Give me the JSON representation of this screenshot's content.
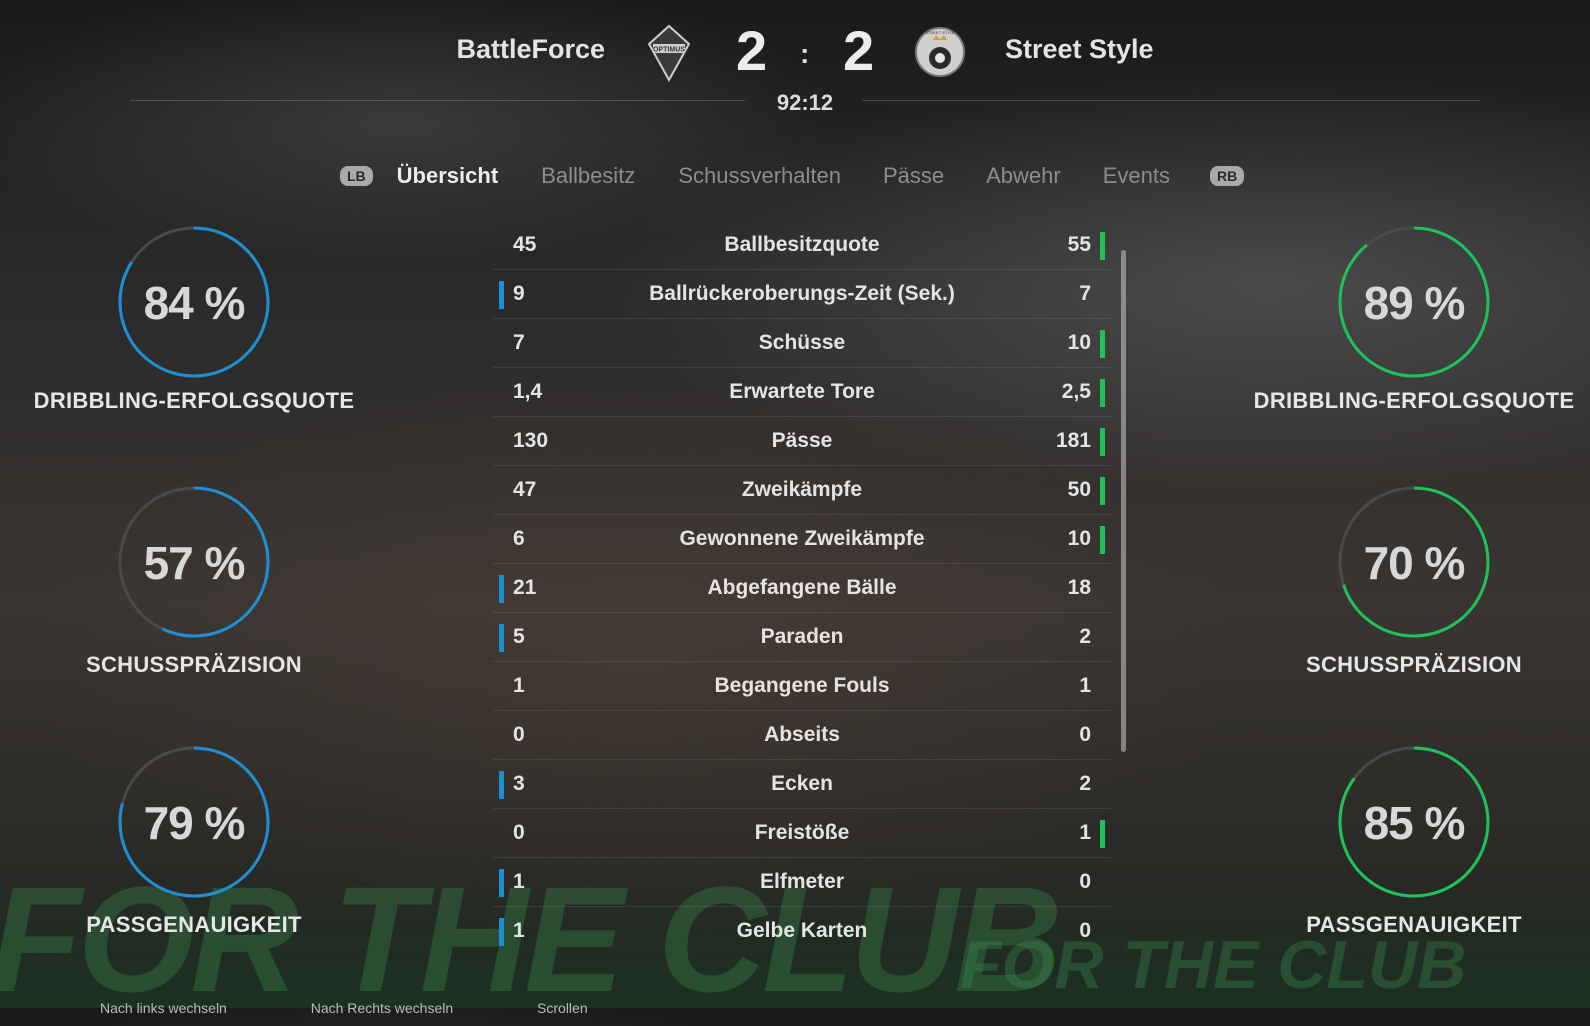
{
  "header": {
    "home_team": "BattleForce",
    "away_team": "Street Style",
    "home_score": "2",
    "away_score": "2",
    "separator": ":",
    "match_clock": "92:12",
    "home_crest_text": "OPTIMUS",
    "away_crest_text": "STREET STYLE"
  },
  "tabs": {
    "left_bumper": "LB",
    "right_bumper": "RB",
    "items": [
      "Übersicht",
      "Ballbesitz",
      "Schussverhalten",
      "Pässe",
      "Abwehr",
      "Events"
    ],
    "active_index": 0
  },
  "home_gauges": [
    {
      "value": "84 %",
      "percent": 84,
      "label": "DRIBBLING-ERFOLGSQUOTE"
    },
    {
      "value": "57 %",
      "percent": 57,
      "label": "SCHUSSPRÄZISION"
    },
    {
      "value": "79 %",
      "percent": 79,
      "label": "PASSGENAUIGKEIT"
    }
  ],
  "away_gauges": [
    {
      "value": "89 %",
      "percent": 89,
      "label": "DRIBBLING-ERFOLGSQUOTE"
    },
    {
      "value": "70 %",
      "percent": 70,
      "label": "SCHUSSPRÄZISION"
    },
    {
      "value": "85 %",
      "percent": 85,
      "label": "PASSGENAUIGKEIT"
    }
  ],
  "stats": [
    {
      "home": "45",
      "name": "Ballbesitzquote",
      "away": "55",
      "leader": "away"
    },
    {
      "home": "9",
      "name": "Ballrückeroberungs-Zeit (Sek.)",
      "away": "7",
      "leader": "home"
    },
    {
      "home": "7",
      "name": "Schüsse",
      "away": "10",
      "leader": "away"
    },
    {
      "home": "1,4",
      "name": "Erwartete Tore",
      "away": "2,5",
      "leader": "away"
    },
    {
      "home": "130",
      "name": "Pässe",
      "away": "181",
      "leader": "away"
    },
    {
      "home": "47",
      "name": "Zweikämpfe",
      "away": "50",
      "leader": "away"
    },
    {
      "home": "6",
      "name": "Gewonnene Zweikämpfe",
      "away": "10",
      "leader": "away"
    },
    {
      "home": "21",
      "name": "Abgefangene Bälle",
      "away": "18",
      "leader": "home"
    },
    {
      "home": "5",
      "name": "Paraden",
      "away": "2",
      "leader": "home"
    },
    {
      "home": "1",
      "name": "Begangene Fouls",
      "away": "1",
      "leader": "none"
    },
    {
      "home": "0",
      "name": "Abseits",
      "away": "0",
      "leader": "none"
    },
    {
      "home": "3",
      "name": "Ecken",
      "away": "2",
      "leader": "home"
    },
    {
      "home": "0",
      "name": "Freistöße",
      "away": "1",
      "leader": "away"
    },
    {
      "home": "1",
      "name": "Elfmeter",
      "away": "0",
      "leader": "home"
    },
    {
      "home": "1",
      "name": "Gelbe Karten",
      "away": "0",
      "leader": "home"
    }
  ],
  "background": {
    "banner_text": "FOR THE CLUB",
    "banner_text_small": "FOR THE CLUB"
  },
  "footer": {
    "hint_left": "Nach links wechseln",
    "hint_right": "Nach Rechts wechseln",
    "hint_scroll": "Scrollen"
  },
  "colors": {
    "home_accent": "#1e8fd2",
    "away_accent": "#1fc25a",
    "tab_inactive": "#8d8d8d"
  }
}
